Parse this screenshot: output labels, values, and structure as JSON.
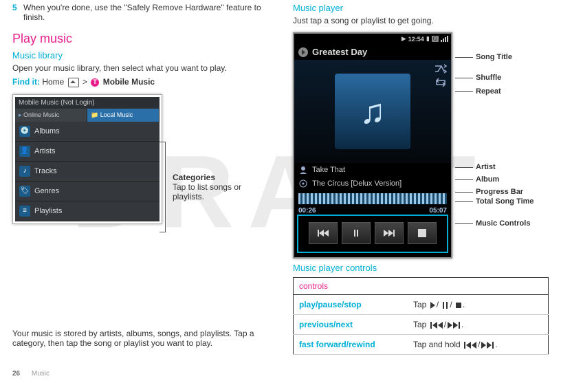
{
  "watermark": "DRAFT",
  "left": {
    "step_num": "5",
    "step_text": "When you're done, use the \"Safely Remove Hardware\" feature to finish.",
    "section": "Play music",
    "sub_library": "Music library",
    "library_intro": "Open your music library, then select what you want to play.",
    "findit_label": "Find it:",
    "findit_home": "Home",
    "findit_sep": ">",
    "findit_app": "Mobile Music",
    "lib_header": "Mobile Music (Not Login)",
    "lib_tab_online": "Online Music",
    "lib_tab_local": "Local Music",
    "lib_rows": [
      "Albums",
      "Artists",
      "Tracks",
      "Genres",
      "Playlists"
    ],
    "annot_title": "Categories",
    "annot_body": "Tap to list songs or playlists.",
    "library_after": "Your music is stored by artists, albums, songs, and playlists. Tap a category, then tap the song or playlist you want to play."
  },
  "right": {
    "sub_player": "Music player",
    "player_intro": "Just tap a song or playlist to get going.",
    "status_time": "12:54",
    "status_g": "G",
    "song_title": "Greatest Day",
    "artist": "Take That",
    "album": "The Circus [Delux Version]",
    "elapsed": "00:26",
    "total": "05:07",
    "labels": {
      "song_title": "Song Title",
      "shuffle": "Shuffle",
      "repeat": "Repeat",
      "artist": "Artist",
      "album": "Album",
      "progress": "Progress Bar",
      "total": "Total Song Time",
      "controls": "Music Controls"
    },
    "sub_controls": "Music player controls",
    "table_header": "controls",
    "rows": {
      "playpause": {
        "label": "play/pause/stop",
        "prefix": "Tap",
        "suffix": "."
      },
      "prevnext": {
        "label": "previous/next",
        "prefix": "Tap",
        "suffix": "."
      },
      "ffrw": {
        "label": "fast forward/rewind",
        "prefix": "Tap and hold",
        "suffix": "."
      }
    }
  },
  "footer": {
    "page": "26",
    "section": "Music"
  }
}
